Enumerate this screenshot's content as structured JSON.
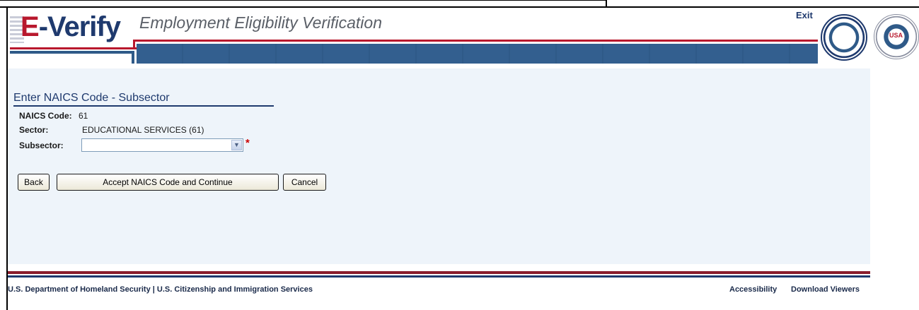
{
  "header": {
    "logo": "E-Verify",
    "tagline": "Employment Eligibility Verification",
    "exit_link": "Exit",
    "ssa_seal_text": "USA"
  },
  "form": {
    "title": "Enter NAICS Code - Subsector",
    "naics_code_label": "NAICS Code:",
    "naics_code_value": "61",
    "sector_label": "Sector:",
    "sector_value": "EDUCATIONAL SERVICES (61)",
    "subsector_label": "Subsector:",
    "subsector_value": "",
    "required_marker": "*"
  },
  "buttons": {
    "back": "Back",
    "accept": "Accept NAICS Code and Continue",
    "cancel": "Cancel"
  },
  "footer": {
    "agencies": "U.S. Department of Homeland Security | U.S. Citizenship and Immigration Services",
    "accessibility": "Accessibility",
    "download_viewers": "Download Viewers"
  },
  "colors": {
    "brand_blue": "#1f3a6e",
    "brand_red": "#b8182d",
    "panel_bg": "#eef4fa"
  }
}
